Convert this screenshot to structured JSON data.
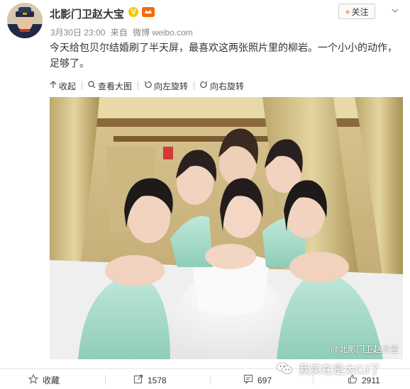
{
  "post": {
    "username": "北影门卫赵大宝",
    "verified_mark": "V",
    "follow_label": "关注",
    "follow_plus": "+",
    "date": "3月30日 23:00",
    "source_prefix": "来自",
    "source": "微博 weibo.com",
    "text": "今天给包贝尔结婚刷了半天屏，最喜欢这两张照片里的柳岩。一个小小的动作，足够了。"
  },
  "image_actions": [
    {
      "label": "收起",
      "icon": "arrow-up-icon"
    },
    {
      "label": "查看大图",
      "icon": "search-icon"
    },
    {
      "label": "向左旋转",
      "icon": "rotate-left-icon"
    },
    {
      "label": "向右旋转",
      "icon": "rotate-right-icon"
    }
  ],
  "photo": {
    "watermark": "@北影门卫赵大宝"
  },
  "bottom_bar": {
    "favorite_label": "收藏",
    "repost_count": "1578",
    "comment_count": "697",
    "like_count": "2911"
  },
  "overlay_watermark": "我实在是太CJ了",
  "colors": {
    "accent_orange": "#ff8140",
    "verified_yellow": "#f7c800",
    "background": "#f2f2f5",
    "dress_mint": "#a9dccb"
  }
}
